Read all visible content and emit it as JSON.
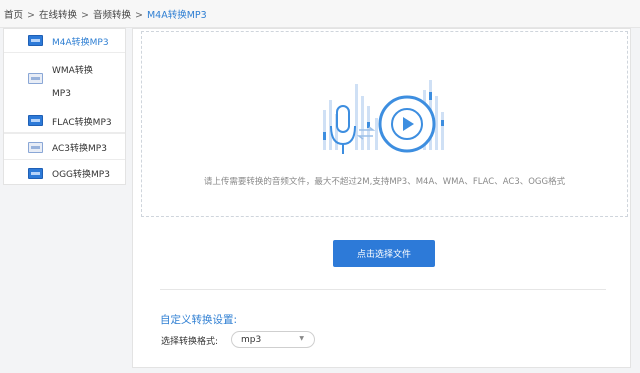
{
  "breadcrumb": {
    "items": [
      "首页",
      "在线转换",
      "音频转换",
      "M4A转换MP3"
    ],
    "separator": ">"
  },
  "sidebar": {
    "items": [
      {
        "label": "M4A转换MP3",
        "icon": "m4a-file-icon",
        "active": true
      },
      {
        "label": "WMA转换",
        "label2": "MP3",
        "icon": "wma-file-icon",
        "active": false
      },
      {
        "label": "FLAC转换MP3",
        "icon": "flac-file-icon",
        "active": false
      },
      {
        "label": "AC3转换MP3",
        "icon": "ac3-file-icon",
        "active": false
      },
      {
        "label": "OGG转换MP3",
        "icon": "ogg-file-icon",
        "active": false
      }
    ]
  },
  "upload": {
    "hint": "请上传需要转换的音频文件，最大不超过2M,支持MP3、M4A、WMA、FLAC、AC3、OGG格式",
    "button_label": "点击选择文件"
  },
  "settings": {
    "title": "自定义转换设置:",
    "format_label": "选择转换格式:",
    "format_value": "mp3"
  },
  "colors": {
    "accent": "#2d7ad8",
    "link": "#2f7fd3",
    "illustration_light": "#cfe0f5",
    "illustration_dark": "#3d8ee0"
  }
}
